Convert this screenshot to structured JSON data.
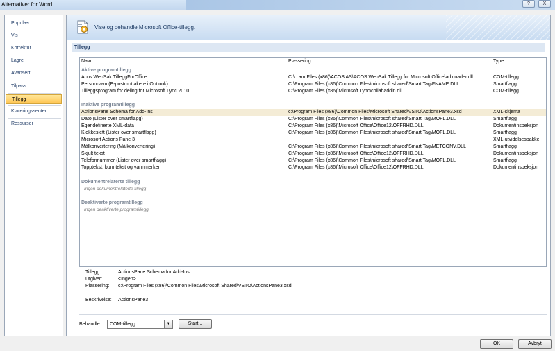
{
  "window": {
    "title": "Alternativer for Word",
    "help_label": "?",
    "close_label": "X"
  },
  "nav": {
    "items": [
      {
        "label": "Populær"
      },
      {
        "label": "Vis"
      },
      {
        "label": "Korrektur"
      },
      {
        "label": "Lagre"
      },
      {
        "label": "Avansert"
      },
      {
        "label": "Tilpass"
      },
      {
        "label": "Tillegg"
      },
      {
        "label": "Klareringssenter"
      },
      {
        "label": "Ressurser"
      }
    ],
    "selected": "Tillegg"
  },
  "banner": {
    "text": "Vise og behandle Microsoft Office-tillegg.",
    "icon": "addins-gear-icon"
  },
  "section": {
    "title": "Tillegg"
  },
  "list": {
    "columns": {
      "name": "Navn",
      "location": "Plassering",
      "type": "Type"
    },
    "groups": [
      {
        "title": "Aktive programtillegg",
        "rows": [
          {
            "name": "Acos.WebSak.TilleggForOffice",
            "location": "C:\\...am Files (x86)\\ACOS AS\\ACOS WebSak Tillegg for Microsoft Office\\adxloader.dll",
            "type": "COM-tillegg"
          },
          {
            "name": "Personnavn (E-postmottakere i Outlook)",
            "location": "C:\\Program Files (x86)\\Common Files\\microsoft shared\\Smart Tag\\FNAME.DLL",
            "type": "Smartflagg"
          },
          {
            "name": "Tilleggsprogram for deling for Microsoft Lync 2010",
            "location": "C:\\Program Files (x86)\\Microsoft Lync\\collabaddin.dll",
            "type": "COM-tillegg"
          }
        ]
      },
      {
        "title": "Inaktive programtillegg",
        "rows": [
          {
            "name": "ActionsPane Schema for Add-Ins",
            "location": "c:\\Program Files (x86)\\Common Files\\Microsoft Shared\\VSTO\\ActionsPane3.xsd",
            "type": "XML-skjema",
            "selected": true
          },
          {
            "name": "Dato (Lister over smartflagg)",
            "location": "C:\\Program Files (x86)\\Common Files\\microsoft shared\\Smart Tag\\MOFL.DLL",
            "type": "Smartflagg"
          },
          {
            "name": "Egendefinerte XML-data",
            "location": "C:\\Program Files (x86)\\Microsoft Office\\Office12\\OFFRHD.DLL",
            "type": "Dokumentinspeksjon"
          },
          {
            "name": "Klokkeslett (Lister over smartflagg)",
            "location": "C:\\Program Files (x86)\\Common Files\\microsoft shared\\Smart Tag\\MOFL.DLL",
            "type": "Smartflagg"
          },
          {
            "name": "Microsoft Actions Pane 3",
            "location": "",
            "type": "XML-utvidelsespakke"
          },
          {
            "name": "Målkonvertering (Målkonvertering)",
            "location": "C:\\Program Files (x86)\\Common Files\\microsoft shared\\Smart Tag\\METCONV.DLL",
            "type": "Smartflagg"
          },
          {
            "name": "Skjult tekst",
            "location": "C:\\Program Files (x86)\\Microsoft Office\\Office12\\OFFRHD.DLL",
            "type": "Dokumentinspeksjon"
          },
          {
            "name": "Telefonnummer (Lister over smartflagg)",
            "location": "C:\\Program Files (x86)\\Common Files\\microsoft shared\\Smart Tag\\MOFL.DLL",
            "type": "Smartflagg"
          },
          {
            "name": "Topptekst, bunntekst og vannmerker",
            "location": "C:\\Program Files (x86)\\Microsoft Office\\Office12\\OFFRHD.DLL",
            "type": "Dokumentinspeksjon"
          }
        ]
      },
      {
        "title": "Dokumentrelaterte tillegg",
        "empty": "Ingen dokumentrelaterte tillegg"
      },
      {
        "title": "Deaktiverte programtillegg",
        "empty": "Ingen deaktiverte programtillegg"
      }
    ]
  },
  "details": {
    "addin_label": "Tillegg:",
    "addin_value": "ActionsPane Schema for Add-Ins",
    "publisher_label": "Utgiver:",
    "publisher_value": "<Ingen>",
    "location_label": "Plassering:",
    "location_value": "c:\\Program Files (x86)\\Common Files\\Microsoft Shared\\VSTO\\ActionsPane3.xsd",
    "description_label": "Beskrivelse:",
    "description_value": "ActionsPane3"
  },
  "manage": {
    "label": "Behandle:",
    "selected": "COM-tillegg",
    "go_label": "Start..."
  },
  "footer": {
    "ok_label": "OK",
    "cancel_label": "Avbryt"
  }
}
